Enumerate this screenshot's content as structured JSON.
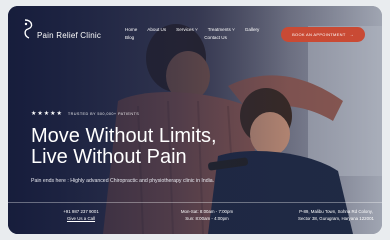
{
  "brand": {
    "name": "Pain Relief Clinic"
  },
  "nav": {
    "items": [
      {
        "label": "Home"
      },
      {
        "label": "About Us"
      },
      {
        "label": "Services"
      },
      {
        "label": "Treatments"
      },
      {
        "label": "Gallery"
      },
      {
        "label": "Blog"
      },
      {
        "label": "Contact Us"
      }
    ]
  },
  "cta": {
    "label": "BOOK AN APPOINTMENT",
    "icon": "arrow-right"
  },
  "hero": {
    "stars": "★★★★★",
    "trust": "TRUSTED BY 500,000+ PATIENTS",
    "headline_line1": "Move Without Limits,",
    "headline_line2": "Live Without Pain",
    "subtitle": "Pain ends here : Highly advanced Chiropractic and physiotherapy clinic in India."
  },
  "info": {
    "phone": "+91 987 237 9001",
    "call_label": "Give Us a Call",
    "hours_line1": "Mon-Sat: 8:00am - 7:00pm",
    "hours_line2": "Sun: 8:00am - 4:00pm",
    "address_line1": "P-89, Malibu Town, Sohna Rd Colony,",
    "address_line2": "Sector 38, Gurugram, Haryana 122001"
  },
  "colors": {
    "accent": "#c94a34",
    "overlay": "#141a38",
    "text": "#ffffff"
  }
}
